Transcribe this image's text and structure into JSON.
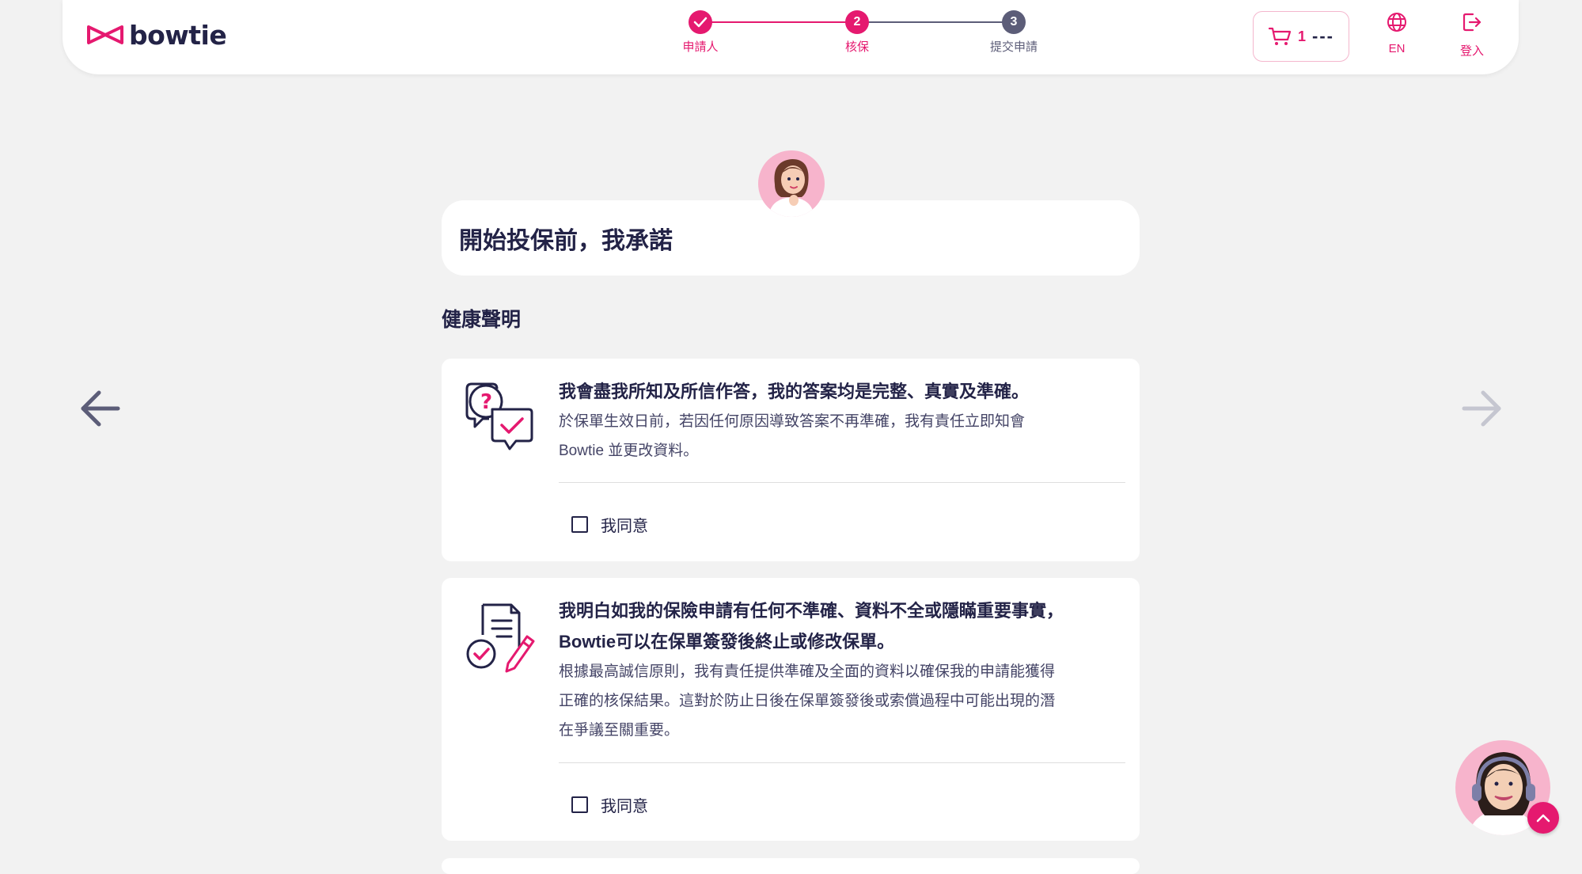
{
  "brand": {
    "name": "bowtie",
    "color": "#e5196f"
  },
  "stepper": {
    "steps": [
      {
        "number": "",
        "label": "申請人",
        "state": "done"
      },
      {
        "number": "2",
        "label": "核保",
        "state": "current"
      },
      {
        "number": "3",
        "label": "提交申請",
        "state": "upcoming"
      }
    ]
  },
  "header": {
    "cart_count": "1",
    "cart_price": "---",
    "language_label": "EN",
    "login_label": "登入"
  },
  "page": {
    "title": "開始投保前，我承諾",
    "section_title": "健康聲明"
  },
  "declarations": [
    {
      "icon": "question-chat-check-icon",
      "heading": [
        "我會盡我所知及所信作答，我的答案均是完整、真實及準確。"
      ],
      "text": [
        "於保單生效日前，若因任何原因導致答案不再準確，我有責任立即知會",
        "Bowtie 並更改資料。"
      ],
      "agree_label": "我同意",
      "checked": false
    },
    {
      "icon": "document-pen-check-icon",
      "heading": [
        "我明白如我的保險申請有任何不準確、資料不全或隱瞞重要事實，",
        "Bowtie可以在保單簽發後終止或修改保單。"
      ],
      "text": [
        "根據最高誠信原則，我有責任提供準確及全面的資料以確保我的申請能獲得",
        "正確的核保結果。這對於防止日後在保單簽發後或索償過程中可能出現的潛",
        "在爭議至關重要。"
      ],
      "agree_label": "我同意",
      "checked": false
    }
  ],
  "colors": {
    "accent": "#e5196f",
    "navy": "#232347",
    "step_inactive": "#5c5d78",
    "background": "#f2f2f2"
  }
}
